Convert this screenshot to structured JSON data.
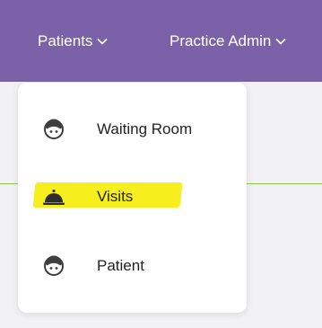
{
  "navbar": {
    "items": [
      {
        "label": "Patients",
        "icon": "chevron-down-icon"
      },
      {
        "label": "Practice Admin",
        "icon": "chevron-down-icon"
      }
    ],
    "background_color": "#7b62a8",
    "text_color": "#ffffff"
  },
  "dropdown": {
    "items": [
      {
        "label": "Waiting Room",
        "icon": "patient-face-icon"
      },
      {
        "label": "Visits",
        "icon": "service-bell-icon",
        "highlighted": true
      },
      {
        "label": "Patient",
        "icon": "patient-face-icon"
      }
    ],
    "highlight_color": "#f7ef1d"
  },
  "accent_line_color": "#8bc34a"
}
